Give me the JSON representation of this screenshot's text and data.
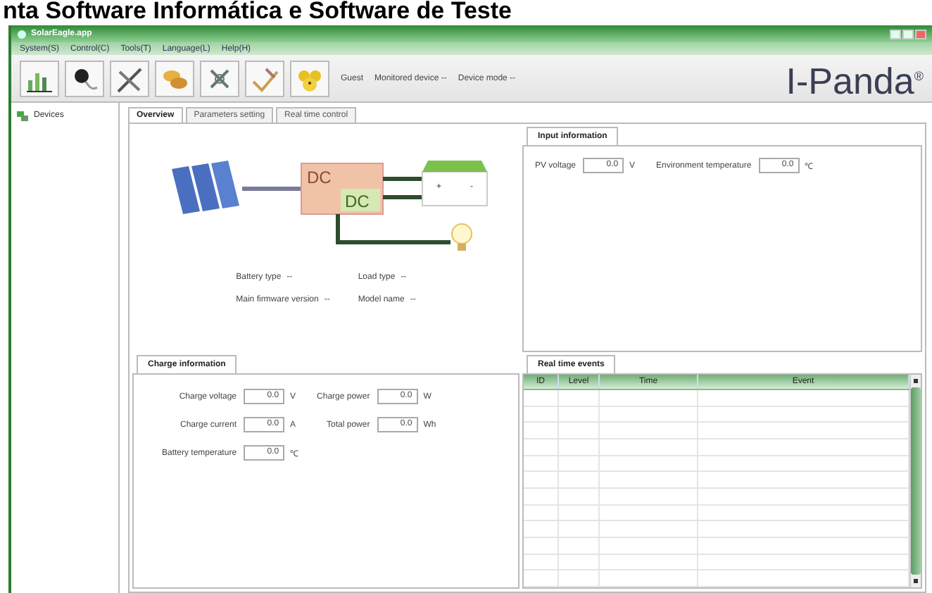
{
  "headline": "nta Software Informática e Software de Teste",
  "window": {
    "title": "SolarEagle.app"
  },
  "menu": [
    "System(S)",
    "Control(C)",
    "Tools(T)",
    "Language(L)",
    "Help(H)"
  ],
  "toolbar": {
    "user": "Guest",
    "monitored_device": "Monitored device --",
    "device_mode": "Device mode --",
    "logo": "I-Panda$^{®}$"
  },
  "sidebar": {
    "items": [
      {
        "label": "Devices"
      }
    ]
  },
  "tabs": [
    {
      "label": "Overview",
      "selected": true
    },
    {
      "label": "Parameters setting",
      "selected": false
    },
    {
      "label": "Real time control",
      "selected": false
    }
  ],
  "diagram": {
    "converter_labels": [
      "DC",
      "DC"
    ],
    "battery_signs": [
      "+",
      "-"
    ]
  },
  "overview_fields": [
    {
      "label": "Battery type",
      "value": "--"
    },
    {
      "label": "Load type",
      "value": "--"
    },
    {
      "label": "Main firmware version",
      "value": "--"
    },
    {
      "label": "Model name",
      "value": "--"
    }
  ],
  "input_information": {
    "title": "Input information",
    "fields": [
      {
        "label": "PV voltage",
        "value": "0.0",
        "unit": "V"
      },
      {
        "label": "Environment temperature",
        "value": "0.0",
        "unit": "℃"
      }
    ]
  },
  "charge_information": {
    "title": "Charge information",
    "fields": [
      {
        "label": "Charge voltage",
        "value": "0.0",
        "unit": "V"
      },
      {
        "label": "Charge power",
        "value": "0.0",
        "unit": "W"
      },
      {
        "label": "Charge current",
        "value": "0.0",
        "unit": "A"
      },
      {
        "label": "Total power",
        "value": "0.0",
        "unit": "Wh"
      },
      {
        "label": "Battery temperature",
        "value": "0.0",
        "unit": "℃"
      }
    ]
  },
  "real_time_events": {
    "title": "Real time events",
    "columns": [
      "ID",
      "Level",
      "Time",
      "Event"
    ]
  }
}
